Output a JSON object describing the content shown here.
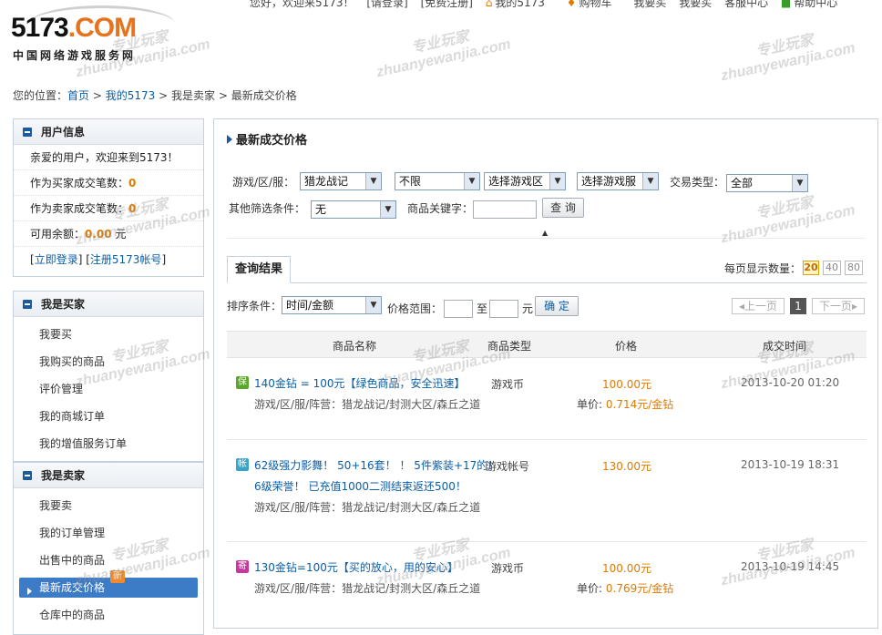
{
  "topbar": {
    "greeting": "您好，欢迎来5173！",
    "login": "[请登录]",
    "register": "[免费注册]",
    "my": "我的5173",
    "cart": "购物车",
    "buy": "我要买",
    "sell": "我要买",
    "service": "客服中心",
    "help": "帮助中心"
  },
  "logo": {
    "num": "5173",
    "dot": ".COM",
    "sub": "中国网络游戏服务网"
  },
  "breadcrumb": {
    "prefix": "您的位置：",
    "home": "首页",
    "my": "我的5173",
    "seller": "我是卖家",
    "current": "最新成交价格",
    "sep": ">"
  },
  "userinfo": {
    "title": "用户信息",
    "welcome": "亲爱的用户，欢迎来到5173！",
    "buyer_label": "作为买家成交笔数：",
    "buyer_count": "0",
    "seller_label": "作为卖家成交笔数：",
    "seller_count": "0",
    "balance_label": "可用余额：",
    "balance": "0.00",
    "balance_unit": "元",
    "login": "立即登录",
    "register": "注册5173帐号"
  },
  "buyer_menu": {
    "title": "我是买家",
    "items": [
      "我要买",
      "我购买的商品",
      "评价管理",
      "我的商城订单",
      "我的增值服务订单"
    ]
  },
  "seller_menu": {
    "title": "我是卖家",
    "items": [
      "我要卖",
      "我的订单管理",
      "出售中的商品",
      "最新成交价格",
      "仓库中的商品"
    ],
    "new_badge": "新"
  },
  "main": {
    "title": "最新成交价格"
  },
  "filter": {
    "game_label": "游戏/区/服：",
    "game": "猎龙战记",
    "area": "不限",
    "zone": "选择游戏区",
    "server": "选择游戏服",
    "trade_label": "交易类型：",
    "trade": "全部",
    "other_label": "其他筛选条件：",
    "other": "无",
    "keyword_label": "商品关键字：",
    "keyword": "",
    "search": "查 询"
  },
  "results": {
    "tab": "查询结果",
    "perpage_label": "每页显示数量：",
    "perpage": [
      "20",
      "40",
      "80"
    ],
    "sort_label": "排序条件：",
    "sort": "时间/金额",
    "range_label": "价格范围：",
    "to": "至",
    "unit": "元",
    "confirm": "确 定",
    "prev": "上一页",
    "page": "1",
    "next": "下一页"
  },
  "table": {
    "headers": [
      "商品名称",
      "商品类型",
      "价格",
      "成交时间"
    ],
    "rows": [
      {
        "tag": "保",
        "tag_color": "#5aa52a",
        "title": "140金钻 = 100元【绿色商品，安全迅速】",
        "title2": "",
        "sub": "游戏/区/服/阵营：猎龙战记/封测大区/森丘之道",
        "type": "游戏币",
        "price": "100.00元",
        "unit_label": "单价:",
        "unit_price": "0.714元/金钻",
        "time": "2013-10-20 01:20"
      },
      {
        "tag": "帐",
        "tag_color": "#39a3c8",
        "title": "62级强力影舞！ 50+16套！ ！ 5件紫装+17的！",
        "title2": "6级荣誉！ 已充值1000二测结束返还500！",
        "sub": "游戏/区/服/阵营：猎龙战记/封测大区/森丘之道",
        "type": "游戏帐号",
        "price": "130.00元",
        "unit_label": "",
        "unit_price": "",
        "time": "2013-10-19 18:31"
      },
      {
        "tag": "寄",
        "tag_color": "#c8379e",
        "title": "130金钻=100元【买的放心，用的安心】",
        "title2": "",
        "sub": "游戏/区/服/阵营：猎龙战记/封测大区/森丘之道",
        "type": "游戏币",
        "price": "100.00元",
        "unit_label": "单价:",
        "unit_price": "0.769元/金钻",
        "time": "2013-10-19 14:45"
      }
    ]
  },
  "watermark": {
    "cn": "专业玩家",
    "en": "zhuanyewanjia.com"
  },
  "colors": {
    "accent": "#3c7bc6",
    "price": "#e07a00",
    "link": "#0a5ea8"
  }
}
